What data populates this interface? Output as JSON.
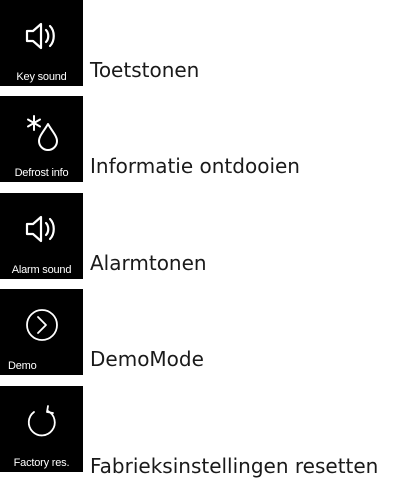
{
  "settings_list": {
    "items": [
      {
        "tile_caption": "Key sound",
        "label": "Toetstonen",
        "icon": "speaker-icon"
      },
      {
        "tile_caption": "Defrost info",
        "label": "Informatie ontdooien",
        "icon": "defrost-drop-icon"
      },
      {
        "tile_caption": "Alarm sound",
        "label": "Alarmtonen",
        "icon": "speaker-icon"
      },
      {
        "tile_caption": "Demo",
        "label": "DemoMode",
        "icon": "chevron-circle-icon"
      },
      {
        "tile_caption": "Factory res.",
        "label": "Fabrieksinstellingen resetten",
        "icon": "reset-arrow-icon"
      }
    ]
  },
  "colors": {
    "tile_background": "#000000",
    "tile_text": "#ffffff",
    "label_text": "#1a1a1a",
    "page_background": "#ffffff"
  }
}
